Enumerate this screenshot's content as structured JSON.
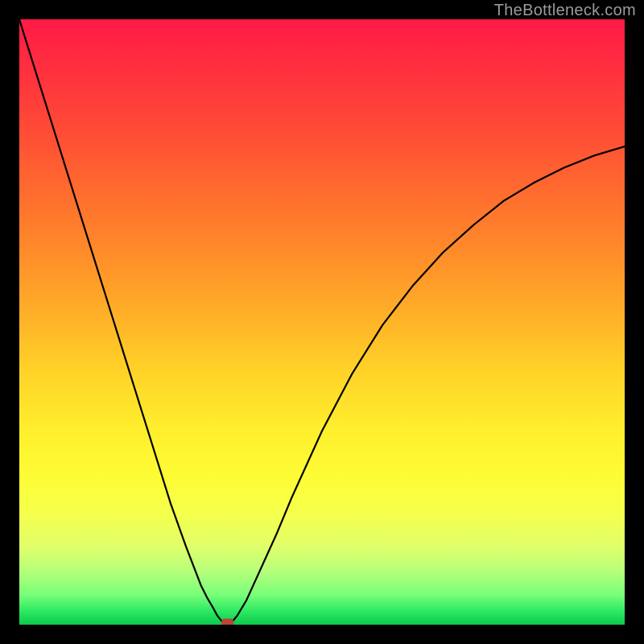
{
  "watermark": "TheBottleneck.com",
  "colors": {
    "frame": "#000000",
    "curve": "#000000",
    "marker": "#b9443a",
    "gradient_top": "#ff1a47",
    "gradient_bottom": "#0cc94c"
  },
  "chart_data": {
    "type": "line",
    "title": "",
    "xlabel": "",
    "ylabel": "",
    "xlim": [
      0,
      1
    ],
    "ylim": [
      0,
      1
    ],
    "x": [
      0.0,
      0.025,
      0.05,
      0.075,
      0.1,
      0.125,
      0.15,
      0.175,
      0.2,
      0.225,
      0.25,
      0.275,
      0.3,
      0.31,
      0.32,
      0.327,
      0.335,
      0.344,
      0.35,
      0.36,
      0.375,
      0.4,
      0.425,
      0.45,
      0.475,
      0.5,
      0.55,
      0.6,
      0.65,
      0.7,
      0.75,
      0.8,
      0.85,
      0.9,
      0.95,
      1.0
    ],
    "values": [
      1.0,
      0.92,
      0.84,
      0.76,
      0.68,
      0.6,
      0.52,
      0.44,
      0.36,
      0.28,
      0.2,
      0.13,
      0.065,
      0.045,
      0.028,
      0.015,
      0.005,
      0.0,
      0.003,
      0.015,
      0.04,
      0.095,
      0.15,
      0.21,
      0.265,
      0.32,
      0.415,
      0.495,
      0.56,
      0.615,
      0.66,
      0.7,
      0.73,
      0.755,
      0.775,
      0.79
    ],
    "marker": {
      "x": 0.344,
      "y": 0.0
    },
    "legend": [],
    "grid": false
  }
}
